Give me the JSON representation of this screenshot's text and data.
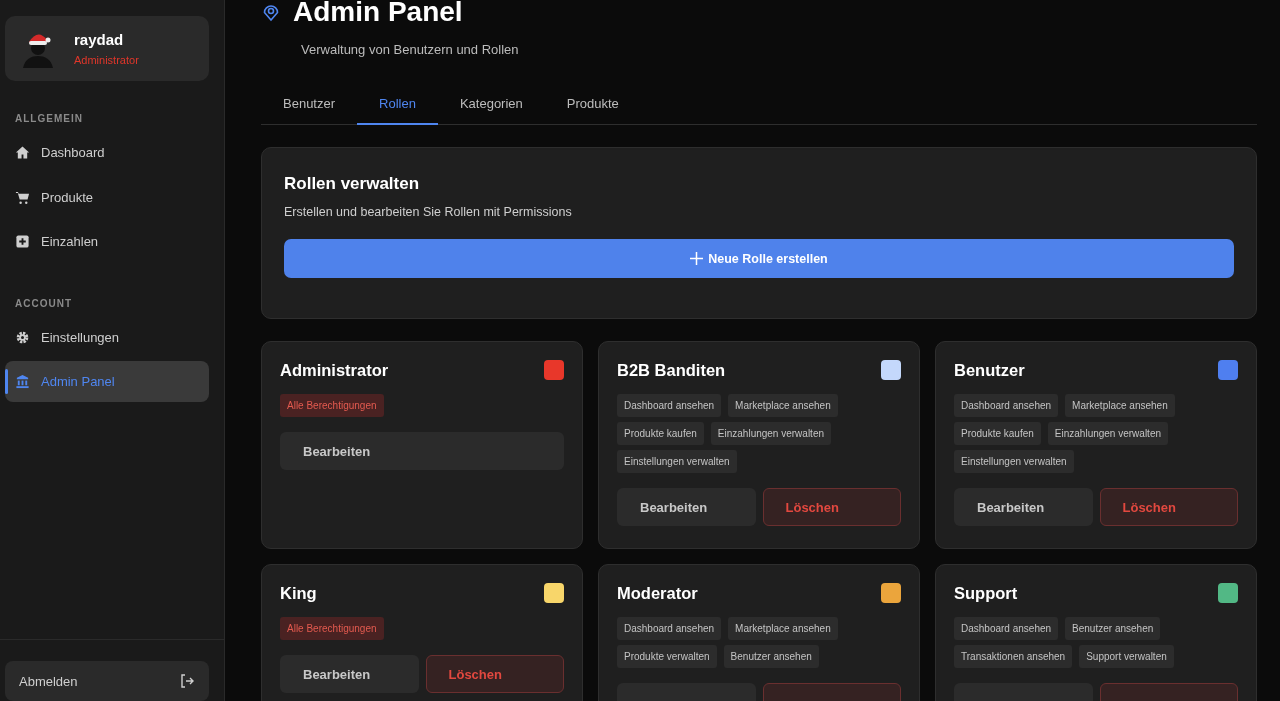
{
  "user": {
    "name": "raydad",
    "role": "Administrator"
  },
  "sidebar": {
    "sections": [
      {
        "title": "ALLGEMEIN",
        "items": [
          {
            "label": "Dashboard",
            "kind": "home",
            "selected": false
          },
          {
            "label": "Produkte",
            "kind": "cart",
            "selected": false
          },
          {
            "label": "Einzahlen",
            "kind": "plus",
            "selected": false
          }
        ]
      },
      {
        "title": "ACCOUNT",
        "items": [
          {
            "label": "Einstellungen",
            "kind": "gear",
            "selected": false
          },
          {
            "label": "Admin Panel",
            "kind": "bank",
            "selected": true
          }
        ]
      }
    ],
    "logout": "Abmelden"
  },
  "header": {
    "title": "Admin Panel",
    "subtitle": "Verwaltung von Benutzern und Rollen"
  },
  "tabs": [
    {
      "label": "Benutzer",
      "selected": false
    },
    {
      "label": "Rollen",
      "selected": true
    },
    {
      "label": "Kategorien",
      "selected": false
    },
    {
      "label": "Produkte",
      "selected": false
    }
  ],
  "manage": {
    "title": "Rollen verwalten",
    "description": "Erstellen und bearbeiten Sie Rollen mit Permissions",
    "button": "Neue Rolle erstellen"
  },
  "roles": [
    {
      "name": "Administrator",
      "color": "#e8372a",
      "permissions": [
        {
          "label": "Alle Berechtigungen",
          "kind": "all"
        }
      ],
      "actions": [
        {
          "kind": "edit",
          "label": "Bearbeiten"
        }
      ]
    },
    {
      "name": "B2B Banditen",
      "color": "#c4d8fb",
      "permissions": [
        {
          "label": "Dashboard ansehen",
          "kind": "normal"
        },
        {
          "label": "Marketplace ansehen",
          "kind": "normal"
        },
        {
          "label": "Produkte kaufen",
          "kind": "normal"
        },
        {
          "label": "Einzahlungen verwalten",
          "kind": "normal"
        },
        {
          "label": "Einstellungen verwalten",
          "kind": "normal"
        }
      ],
      "actions": [
        {
          "kind": "edit",
          "label": "Bearbeiten"
        },
        {
          "kind": "delete",
          "label": "Löschen"
        }
      ]
    },
    {
      "name": "Benutzer",
      "color": "#4f7ff0",
      "permissions": [
        {
          "label": "Dashboard ansehen",
          "kind": "normal"
        },
        {
          "label": "Marketplace ansehen",
          "kind": "normal"
        },
        {
          "label": "Produkte kaufen",
          "kind": "normal"
        },
        {
          "label": "Einzahlungen verwalten",
          "kind": "normal"
        },
        {
          "label": "Einstellungen verwalten",
          "kind": "normal"
        }
      ],
      "actions": [
        {
          "kind": "edit",
          "label": "Bearbeiten"
        },
        {
          "kind": "delete",
          "label": "Löschen"
        }
      ]
    },
    {
      "name": "King",
      "color": "#f8d66a",
      "permissions": [
        {
          "label": "Alle Berechtigungen",
          "kind": "all"
        }
      ],
      "actions": [
        {
          "kind": "edit",
          "label": "Bearbeiten"
        },
        {
          "kind": "delete",
          "label": "Löschen"
        }
      ]
    },
    {
      "name": "Moderator",
      "color": "#eba53c",
      "permissions": [
        {
          "label": "Dashboard ansehen",
          "kind": "normal"
        },
        {
          "label": "Marketplace ansehen",
          "kind": "normal"
        },
        {
          "label": "Produkte verwalten",
          "kind": "normal"
        },
        {
          "label": "Benutzer ansehen",
          "kind": "normal"
        }
      ],
      "actions": [
        {
          "kind": "edit"
        },
        {
          "kind": "delete"
        }
      ]
    },
    {
      "name": "Support",
      "color": "#52b885",
      "permissions": [
        {
          "label": "Dashboard ansehen",
          "kind": "normal"
        },
        {
          "label": "Benutzer ansehen",
          "kind": "normal"
        },
        {
          "label": "Transaktionen ansehen",
          "kind": "normal"
        },
        {
          "label": "Support verwalten",
          "kind": "normal"
        }
      ],
      "actions": [
        {
          "kind": "edit"
        },
        {
          "kind": "delete"
        }
      ]
    }
  ]
}
